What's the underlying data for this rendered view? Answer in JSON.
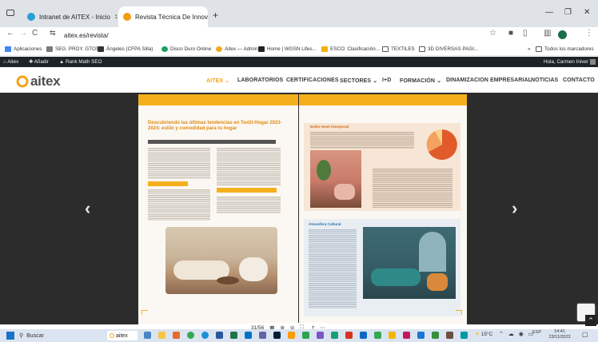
{
  "browser": {
    "tabs": [
      {
        "title": "Intranet de AITEX - Inicio",
        "active": false
      },
      {
        "title": "Revista Técnica De Innovación",
        "active": true
      }
    ],
    "new_tab": "+",
    "url": "aitex.es/revista/",
    "bookmarks": [
      {
        "label": "Aplicaciones",
        "color": "#4285f4"
      },
      {
        "label": "SEG. PROY. GTOS.",
        "color": "#7a7a7a"
      },
      {
        "label": "Ángeles (CFPA Silla)",
        "color": "#333333"
      },
      {
        "label": "Disco Duro Online",
        "color": "#1aa260"
      },
      {
        "label": "Aitex — Admin",
        "color": "#f5a623"
      },
      {
        "label": "Home | WGSN Lifes...",
        "color": "#1d2327"
      },
      {
        "label": "ESCO: Clasificación...",
        "color": "#f0b400"
      },
      {
        "label": "TEXTILES",
        "color": "#555555"
      },
      {
        "label": "3D DIVERSAS PAGI...",
        "color": "#555555"
      }
    ],
    "bookmarks_more": "»",
    "other_bookmarks": "Todos los marcadores"
  },
  "admin_bar": {
    "site": "Aitex",
    "add": "Añadir",
    "rank": "Rank Math SEO",
    "greeting": "Hola, Carmen Iniver"
  },
  "site": {
    "logo": "aitex",
    "menu": [
      {
        "label": "AITEX",
        "active": true
      },
      {
        "label": "LABORATORIOS",
        "active": false
      },
      {
        "label": "CERTIFICACIONES",
        "active": false
      },
      {
        "label": "SECTORES",
        "active": false
      },
      {
        "label": "I+D",
        "active": false
      },
      {
        "label": "FORMACIÓN",
        "active": false
      },
      {
        "label": "DINAMIZACION EMPRESARIAL",
        "active": false
      },
      {
        "label": "NOTICIAS",
        "active": false
      },
      {
        "label": "CONTACTO",
        "active": false
      }
    ]
  },
  "magazine": {
    "left_title": "Descubriendo las últimas tendencias en Textil-Hogar 2023-2024: estilo y comodidad para tu hogar",
    "right_heading": "Estilo Hotel Atemporal",
    "right_section": "Atmosfera Cultural",
    "page_indicator": "31/56",
    "colors": {
      "accent": "#f3b01c",
      "pie1": "#e05a2a",
      "pie2": "#f4a261",
      "pie3": "#f7d38a"
    }
  },
  "taskbar": {
    "search": "Buscar",
    "app": "aitex",
    "weather": "15°C",
    "lang": "ESP",
    "time": "14:41",
    "date": "23/11/2023"
  }
}
